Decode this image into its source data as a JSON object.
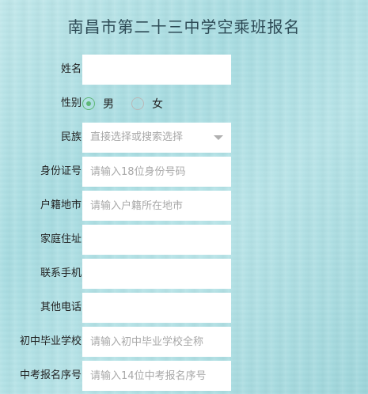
{
  "title": "南昌市第二十三中学空乘班报名",
  "form": {
    "name": {
      "label": "姓名",
      "value": "",
      "placeholder": ""
    },
    "gender": {
      "label": "性别",
      "options": [
        {
          "label": "男",
          "checked": true
        },
        {
          "label": "女",
          "checked": false
        }
      ]
    },
    "ethnicity": {
      "label": "民族",
      "placeholder": "直接选择或搜索选择"
    },
    "id_number": {
      "label": "身份证号",
      "value": "",
      "placeholder": "请输入18位身份号码"
    },
    "hukou": {
      "label": "户籍地市",
      "value": "",
      "placeholder": "请输入户籍所在地市"
    },
    "address": {
      "label": "家庭住址",
      "value": "",
      "placeholder": ""
    },
    "phone": {
      "label": "联系手机",
      "value": "",
      "placeholder": ""
    },
    "other_phone": {
      "label": "其他电话",
      "value": "",
      "placeholder": ""
    },
    "middle_school": {
      "label": "初中毕业学校",
      "value": "",
      "placeholder": "请输入初中毕业学校全称"
    },
    "exam_number": {
      "label": "中考报名序号",
      "value": "",
      "placeholder": "请输入14位中考报名序号"
    }
  },
  "colors": {
    "background": "#a8dde2",
    "radio_checked": "#5fb878",
    "title": "#2d4a55"
  }
}
